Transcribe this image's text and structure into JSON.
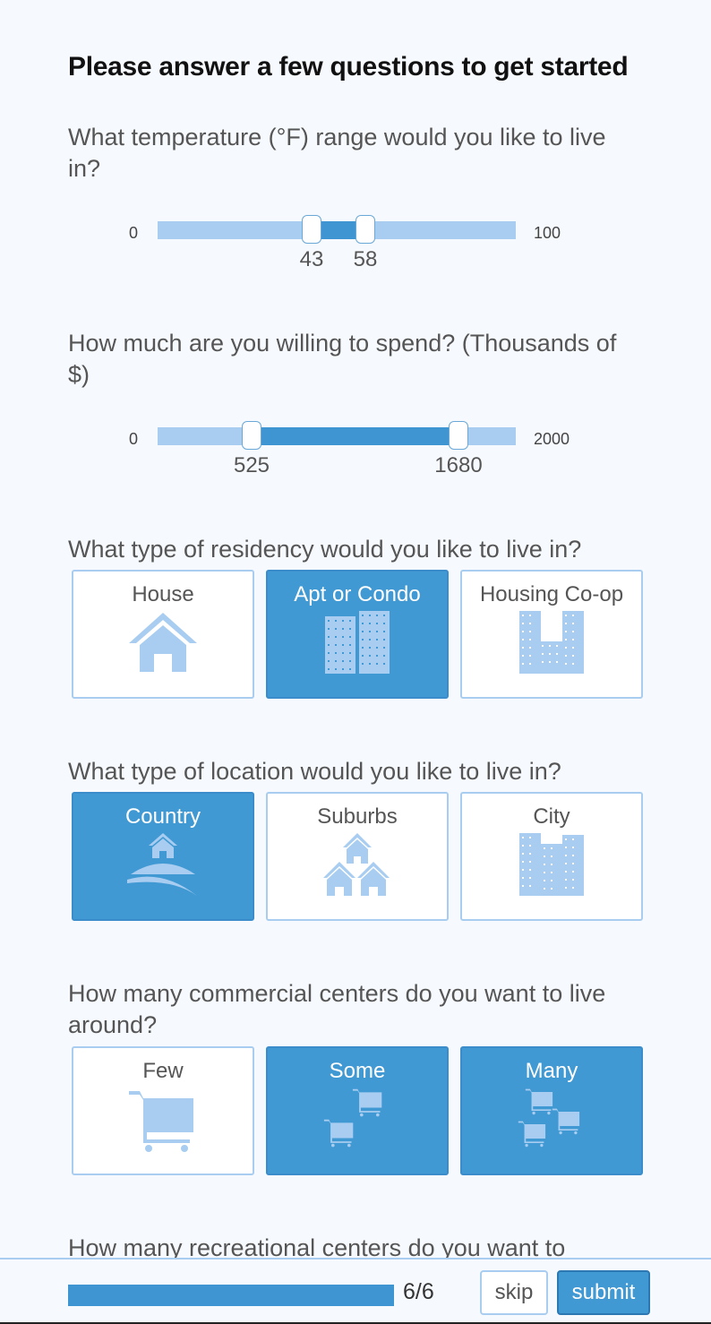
{
  "page": {
    "title": "Please answer a few questions to get started"
  },
  "questions": {
    "temperature": {
      "text": "What temperature (°F) range would you like to live in?",
      "min_label": "0",
      "max_label": "100",
      "min": 0,
      "max": 100,
      "low": 43,
      "high": 58,
      "low_label": "43",
      "high_label": "58"
    },
    "budget": {
      "text": "How much are you willing to spend? (Thousands of $)",
      "min_label": "0",
      "max_label": "2000",
      "min": 0,
      "max": 2000,
      "low": 525,
      "high": 1680,
      "low_label": "525",
      "high_label": "1680"
    },
    "residency": {
      "text": "What type of residency would you like to live in?",
      "options": [
        {
          "label": "House",
          "icon": "house-icon",
          "selected": false
        },
        {
          "label": "Apt or Condo",
          "icon": "apartment-icon",
          "selected": true
        },
        {
          "label": "Housing Co-op",
          "icon": "co-op-building-icon",
          "selected": false
        }
      ]
    },
    "location": {
      "text": "What type of location would you like to live in?",
      "options": [
        {
          "label": "Country",
          "icon": "country-house-hill-icon",
          "selected": true
        },
        {
          "label": "Suburbs",
          "icon": "suburb-houses-icon",
          "selected": false
        },
        {
          "label": "City",
          "icon": "city-buildings-icon",
          "selected": false
        }
      ]
    },
    "commercial": {
      "text": "How many commercial centers do you want to live around?",
      "options": [
        {
          "label": "Few",
          "icon": "shopping-cart-icon",
          "selected": false
        },
        {
          "label": "Some",
          "icon": "two-carts-icon",
          "selected": true
        },
        {
          "label": "Many",
          "icon": "three-carts-icon",
          "selected": true
        }
      ]
    },
    "recreational": {
      "text": "How many recreational centers do you want to"
    }
  },
  "footer": {
    "progress_text": "6/6",
    "progress_fraction": 1.0,
    "skip_label": "skip",
    "submit_label": "submit"
  },
  "colors": {
    "accent": "#4199d3",
    "track": "#a8cdf0",
    "background": "#f6f9fd"
  }
}
